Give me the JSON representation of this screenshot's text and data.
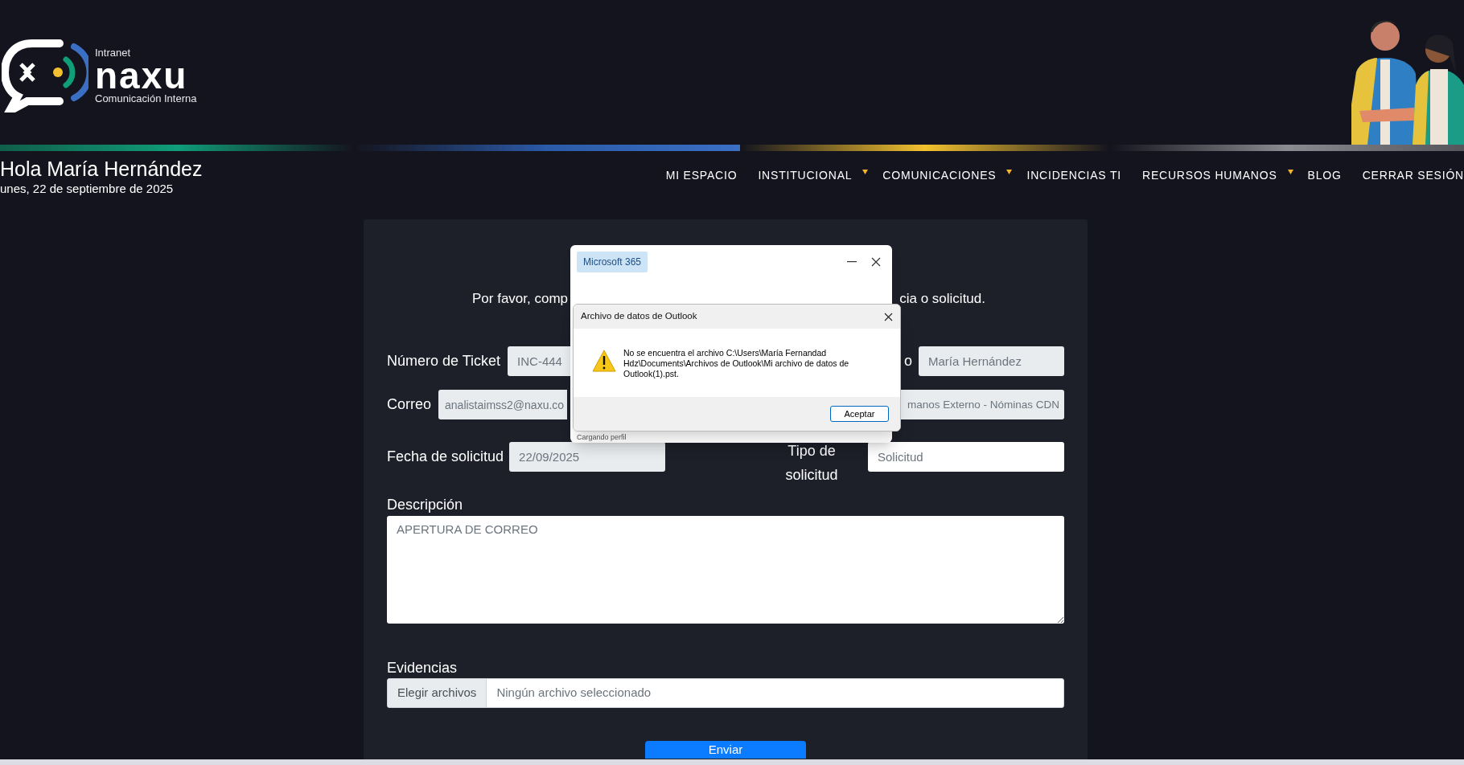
{
  "header": {
    "logo": {
      "tagline_top": "Intranet",
      "wordmark": "naxu",
      "tagline_bottom": "Comunicación Interna"
    },
    "greeting": "Hola María Hernández",
    "date": "unes, 22 de septiembre de 2025"
  },
  "nav": [
    {
      "label": "MI ESPACIO",
      "dropdown": false
    },
    {
      "label": "INSTITUCIONAL",
      "dropdown": true
    },
    {
      "label": "COMUNICACIONES",
      "dropdown": true
    },
    {
      "label": "INCIDENCIAS TI",
      "dropdown": false
    },
    {
      "label": "RECURSOS HUMANOS",
      "dropdown": true
    },
    {
      "label": "BLOG",
      "dropdown": false
    },
    {
      "label": "CERRAR SESIÓN",
      "dropdown": false
    }
  ],
  "form": {
    "instruction_start": "Por favor, comp",
    "instruction_end": "cia o solicitud.",
    "ticket": {
      "label": "Número de Ticket",
      "value": "INC-444",
      "readonly": true
    },
    "user": {
      "label": "o",
      "value": "María Hernández",
      "readonly": true
    },
    "email": {
      "label": "Correo",
      "value": "analistaimss2@naxu.co",
      "readonly": true
    },
    "area": {
      "value": "manos Externo - Nóminas CDN",
      "readonly": true
    },
    "date": {
      "label": "Fecha de solicitud",
      "value": "22/09/2025",
      "readonly": true
    },
    "type": {
      "label": "Tipo de solicitud",
      "value": "Solicitud",
      "readonly": false
    },
    "description": {
      "label": "Descripción",
      "value": "APERTURA DE CORREO"
    },
    "evidence": {
      "label": "Evidencias",
      "button": "Elegir archivos",
      "status": "Ningún archivo seleccionado"
    },
    "submit": "Enviar"
  },
  "dialog": {
    "app_badge": "Microsoft 365",
    "status": "Cargando perfil",
    "alert": {
      "title": "Archivo de datos de Outlook",
      "message": "No se encuentra el archivo C:\\Users\\María Fernandad Hdz\\Documents\\Archivos de Outlook\\Mi archivo de datos de Outlook(1).pst.",
      "button": "Aceptar"
    }
  }
}
